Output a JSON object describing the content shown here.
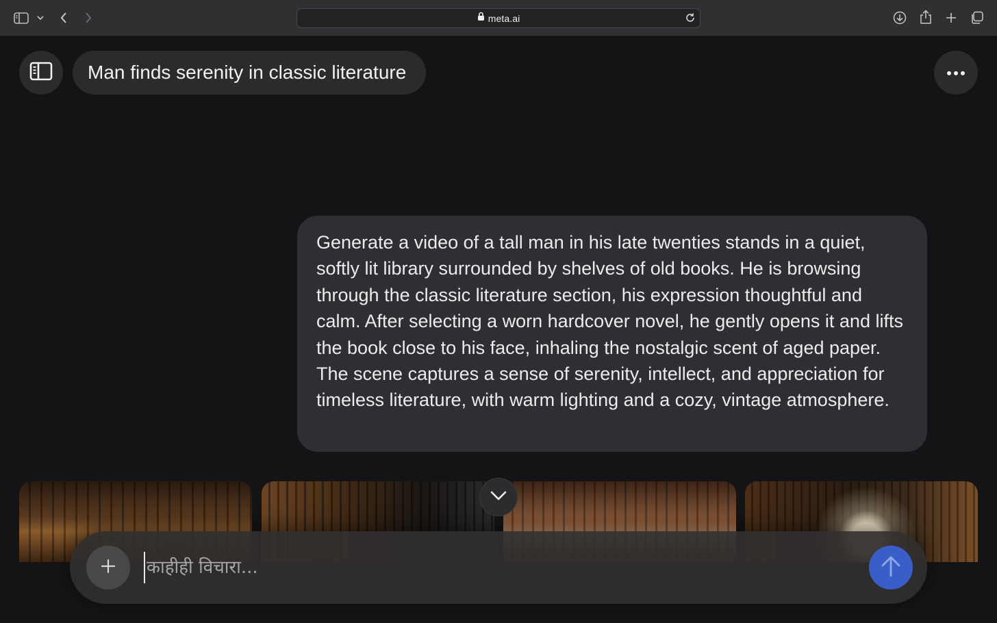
{
  "browser": {
    "url": "meta.ai",
    "icons": [
      "sidebar-icon",
      "chevron-down-icon",
      "back-icon",
      "forward-icon",
      "lock-icon",
      "reload-icon",
      "download-icon",
      "share-icon",
      "new-tab-icon",
      "tabs-overview-icon"
    ]
  },
  "header": {
    "title": "Man finds serenity in classic literature",
    "icons": [
      "sidebar-panel-icon",
      "more-icon"
    ]
  },
  "message": {
    "text": "Generate a video of a tall man in his late twenties stands in a quiet, softly lit library surrounded by shelves of old books. He is browsing through the classic literature section, his expression thoughtful and calm. After selecting a worn hardcover novel, he gently opens it and lifts the book close to his face, inhaling the nostalgic scent of aged paper. The scene captures a sense of serenity, intellect, and appreciation for timeless literature, with warm lighting and a cozy, vintage atmosphere."
  },
  "composer": {
    "placeholder": "काहीही विचारा...",
    "icons": [
      "plus-icon",
      "arrow-up-icon",
      "chevron-down-icon"
    ]
  },
  "colors": {
    "background": "#141416",
    "surface": "#2b2b2e",
    "bubble": "#2f2f33",
    "send_accent": "#3a5ec8"
  }
}
